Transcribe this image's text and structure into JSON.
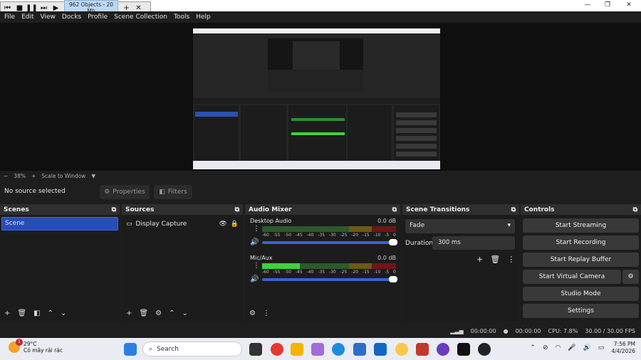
{
  "recorder_bar": {
    "label": "962 Objects - 20 Mb"
  },
  "menu": [
    "File",
    "Edit",
    "View",
    "Docks",
    "Profile",
    "Scene Collection",
    "Tools",
    "Help"
  ],
  "zoom": {
    "level": "38%",
    "mode": "Scale to Window"
  },
  "source_bar": {
    "no_source": "No source selected",
    "properties": "Properties",
    "filters": "Filters"
  },
  "scenes": {
    "title": "Scenes",
    "items": [
      "Scene"
    ]
  },
  "sources": {
    "title": "Sources",
    "items": [
      "Display Capture"
    ]
  },
  "mixer": {
    "title": "Audio Mixer",
    "ticks": [
      "-60",
      "-55",
      "-50",
      "-45",
      "-40",
      "-35",
      "-30",
      "-25",
      "-20",
      "-15",
      "-10",
      "-5",
      "0"
    ],
    "channels": [
      {
        "name": "Desktop Audio",
        "db": "0.0 dB",
        "level": 0
      },
      {
        "name": "Mic/Aux",
        "db": "0.0 dB",
        "level": 0.28
      }
    ]
  },
  "transitions": {
    "title": "Scene Transitions",
    "selected": "Fade",
    "duration_label": "Duration",
    "duration": "300 ms"
  },
  "controls": {
    "title": "Controls",
    "start_streaming": "Start Streaming",
    "start_recording": "Start Recording",
    "start_replay": "Start Replay Buffer",
    "start_vcam": "Start Virtual Camera",
    "studio_mode": "Studio Mode",
    "settings": "Settings"
  },
  "status": {
    "stream_time": "00:00:00",
    "rec_time": "00:00:00",
    "cpu": "CPU: 7.8%",
    "fps": "30.00 / 30.00 FPS"
  },
  "taskbar": {
    "temp": "29°C",
    "weather": "Có mây rải rác",
    "search": "Search",
    "time": "7:56 PM",
    "date": "4/4/2026"
  }
}
